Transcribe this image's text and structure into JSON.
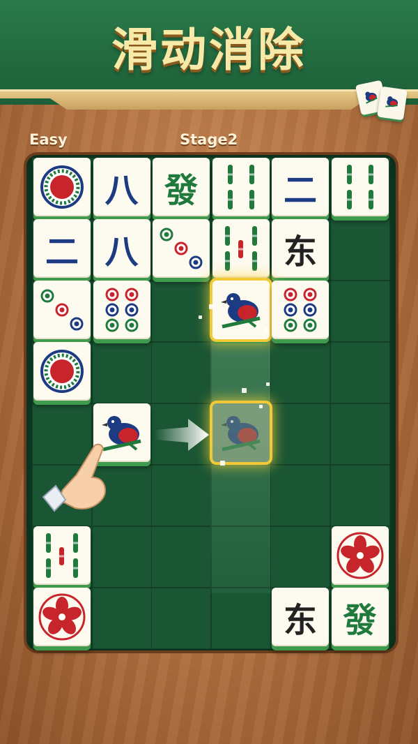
{
  "title": "滑动消除",
  "difficulty": "Easy",
  "stage": "Stage2",
  "chars": {
    "eight": "八",
    "two": "二",
    "fa": "發",
    "dong": "东"
  },
  "colors": {
    "board": "#0f3f26",
    "tile": "#fdfaef",
    "tile_edge": "#3f9a4e",
    "highlight": "#f2c936",
    "red": "#c8242b",
    "blue": "#1d3b82",
    "green": "#1f7a3c"
  },
  "tiles": [
    {
      "row": 0,
      "col": 0,
      "kind": "circle-red"
    },
    {
      "row": 0,
      "col": 1,
      "kind": "eight"
    },
    {
      "row": 0,
      "col": 2,
      "kind": "fa"
    },
    {
      "row": 0,
      "col": 3,
      "kind": "bamboo-4"
    },
    {
      "row": 0,
      "col": 4,
      "kind": "two"
    },
    {
      "row": 0,
      "col": 5,
      "kind": "bamboo-4"
    },
    {
      "row": 1,
      "col": 0,
      "kind": "two"
    },
    {
      "row": 1,
      "col": 1,
      "kind": "eight"
    },
    {
      "row": 1,
      "col": 2,
      "kind": "circle-3"
    },
    {
      "row": 1,
      "col": 3,
      "kind": "bamboo-5"
    },
    {
      "row": 1,
      "col": 4,
      "kind": "dong"
    },
    {
      "row": 2,
      "col": 0,
      "kind": "circle-3"
    },
    {
      "row": 2,
      "col": 1,
      "kind": "circle-6"
    },
    {
      "row": 2,
      "col": 3,
      "kind": "bird",
      "state": "highlighted"
    },
    {
      "row": 2,
      "col": 4,
      "kind": "circle-6"
    },
    {
      "row": 3,
      "col": 0,
      "kind": "circle-red"
    },
    {
      "row": 4,
      "col": 1,
      "kind": "bird"
    },
    {
      "row": 4,
      "col": 3,
      "kind": "bird",
      "state": "ghost"
    },
    {
      "row": 6,
      "col": 0,
      "kind": "bamboo-5"
    },
    {
      "row": 6,
      "col": 5,
      "kind": "flower"
    },
    {
      "row": 7,
      "col": 0,
      "kind": "flower"
    },
    {
      "row": 7,
      "col": 4,
      "kind": "dong"
    },
    {
      "row": 7,
      "col": 5,
      "kind": "fa"
    }
  ],
  "icons": [
    "swipe-arrow-icon",
    "pointing-hand-icon",
    "sparkle-icon",
    "corner-tiles-icon"
  ]
}
